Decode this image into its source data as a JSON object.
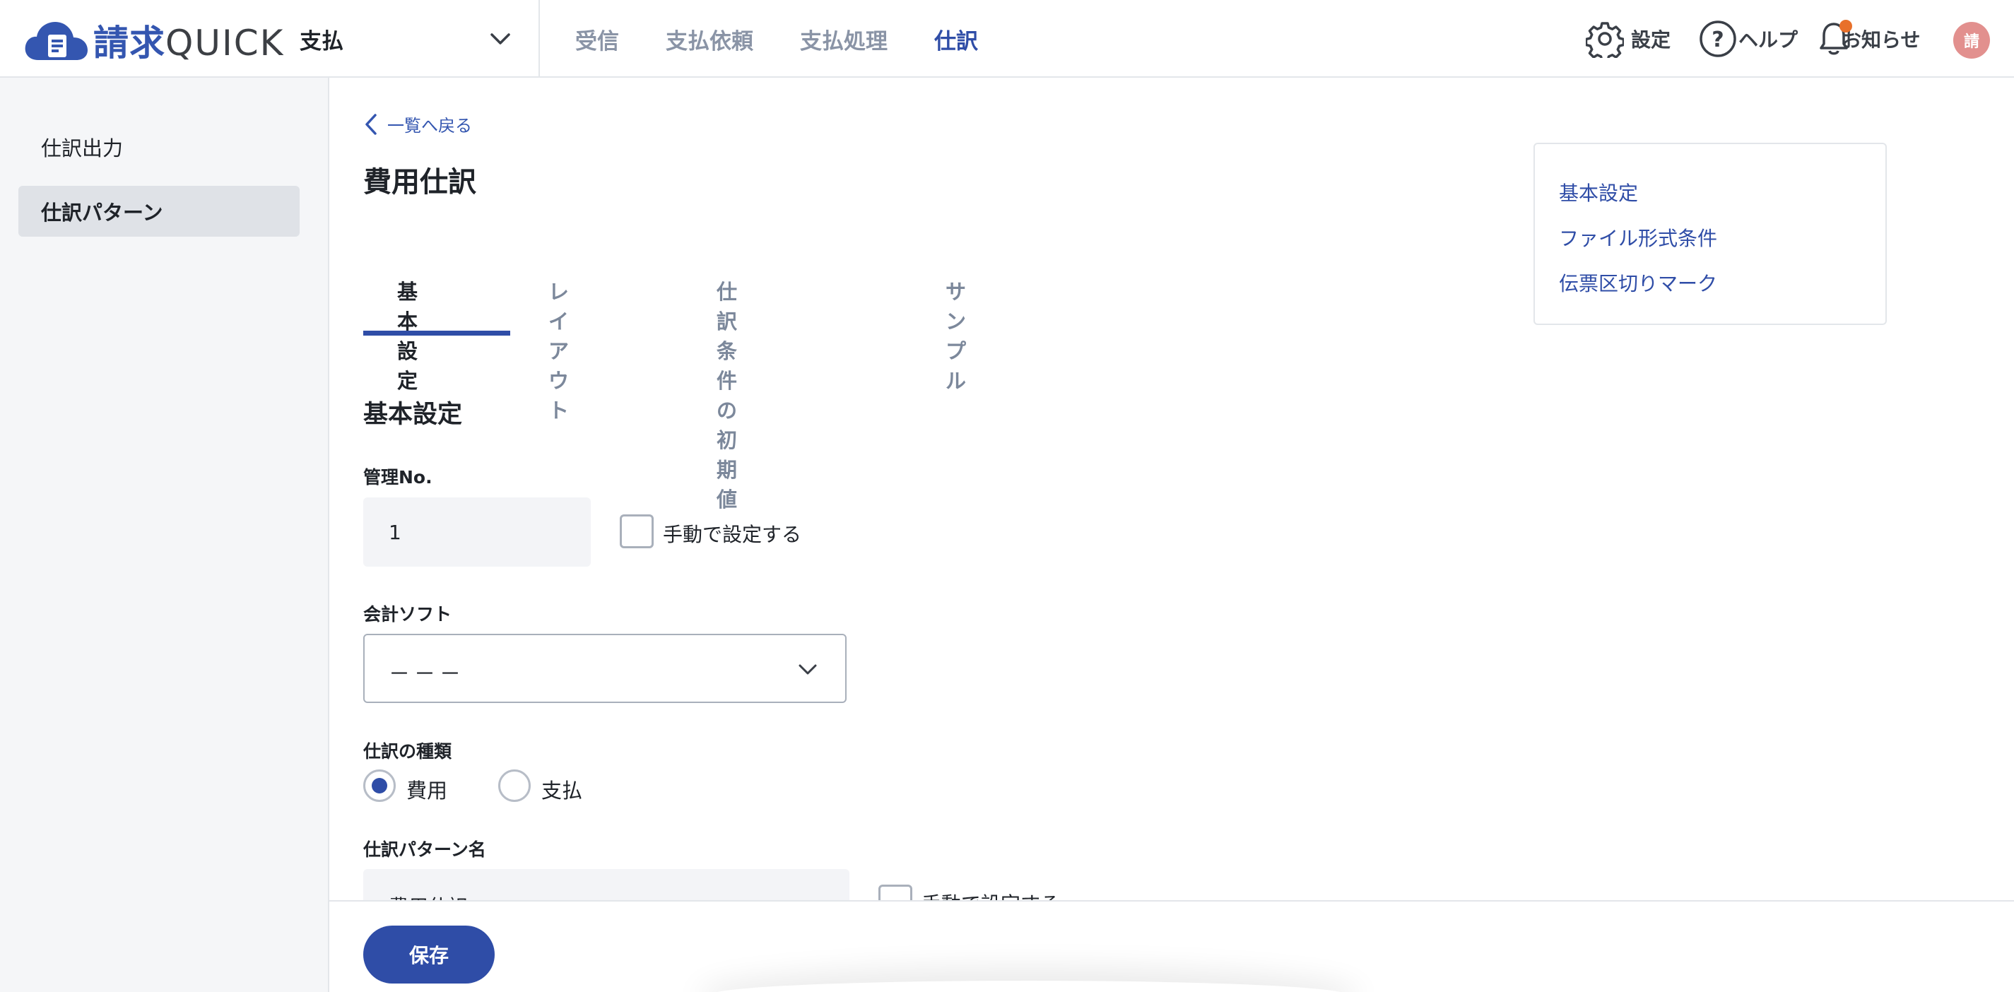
{
  "app": {
    "logo_kanji": "請求",
    "logo_latin": "QUICK",
    "account_label": "支払"
  },
  "nav": {
    "items": [
      "受信",
      "支払依頼",
      "支払処理",
      "仕訳"
    ],
    "active": "仕訳"
  },
  "utility": {
    "settings_label": "設定",
    "help_label": "ヘルプ",
    "notice_label": "お知らせ",
    "avatar_initial": "請"
  },
  "sidebar": {
    "items": [
      {
        "label": "仕訳出力"
      },
      {
        "label": "仕訳パターン"
      }
    ],
    "active": "仕訳パターン"
  },
  "page": {
    "back_label": "一覧へ戻る",
    "title": "費用仕訳"
  },
  "tabs": {
    "items": [
      "基本設定",
      "レイアウト",
      "仕訳条件の初期値",
      "サンプル"
    ],
    "active": "基本設定"
  },
  "toc": {
    "items": [
      "基本設定",
      "ファイル形式条件",
      "伝票区切りマーク"
    ]
  },
  "form": {
    "section_title": "基本設定",
    "management_no": {
      "label": "管理No.",
      "value": "1",
      "manual_label": "手動で設定する",
      "manual_checked": false
    },
    "accounting_software": {
      "label": "会計ソフト",
      "value": "－－－"
    },
    "journal_type": {
      "label": "仕訳の種類",
      "options": [
        "費用",
        "支払"
      ],
      "selected": "費用"
    },
    "pattern_name": {
      "label": "仕訳パターン名",
      "value": "費用仕訳",
      "manual_label": "手動で設定する",
      "manual_checked": false
    }
  },
  "footer": {
    "save_label": "保存"
  },
  "colors": {
    "brand": "#2f4da7",
    "logo_blue": "#3456b0",
    "notification_dot": "#e8702a",
    "avatar": "#e2908e"
  },
  "icons": [
    "cloud-logo-icon",
    "chevron-down-icon",
    "gear-icon",
    "help-circle-icon",
    "bell-icon",
    "chevron-left-icon"
  ]
}
